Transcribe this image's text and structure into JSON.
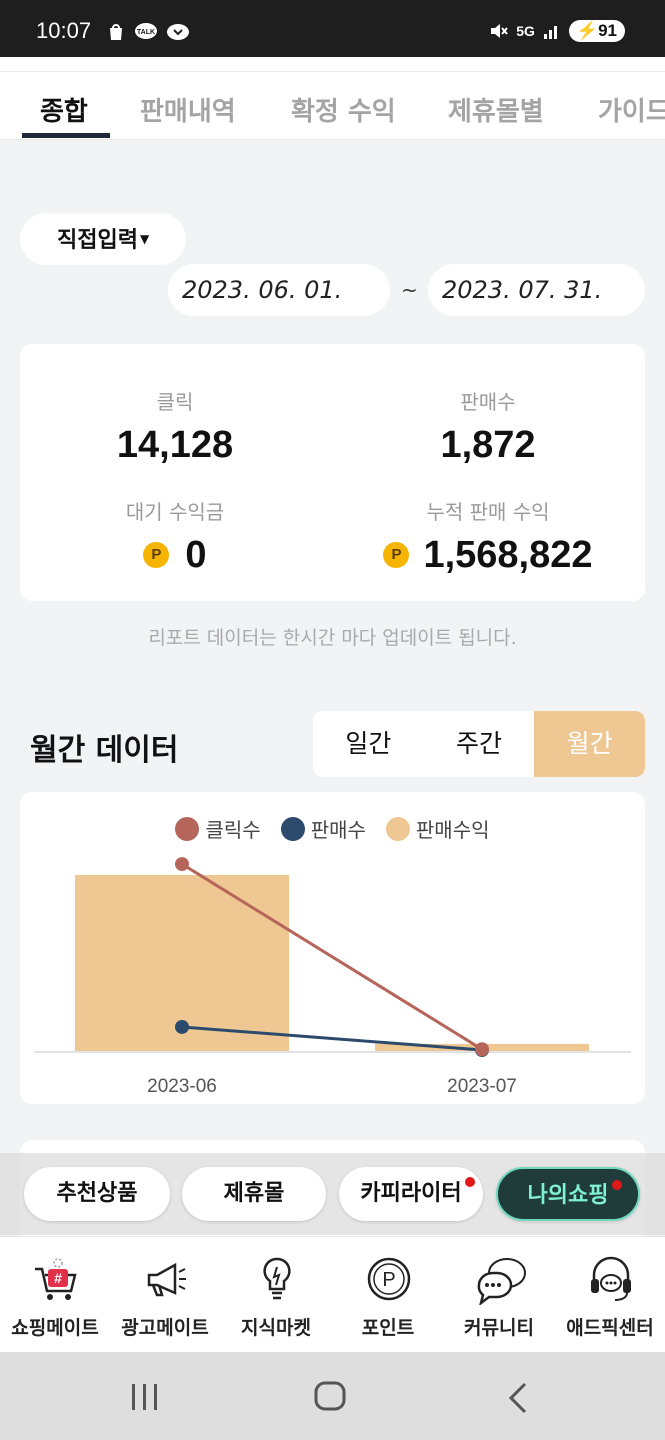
{
  "status_bar": {
    "time": "10:07",
    "left_icons": [
      "shopping-bag-icon",
      "kakaotalk-icon",
      "cloud-chat-icon"
    ],
    "network": "5G",
    "battery": "91"
  },
  "tabs": [
    {
      "label": "종합",
      "active": true
    },
    {
      "label": "판매내역",
      "active": false
    },
    {
      "label": "확정 수익",
      "active": false
    },
    {
      "label": "제휴몰별",
      "active": false
    },
    {
      "label": "가이드",
      "active": false
    }
  ],
  "date_filter": {
    "mode_label": "직접입력",
    "start_date": "2023. 06. 01.",
    "separator": "~",
    "end_date": "2023. 07. 31."
  },
  "summary": {
    "clicks_label": "클릭",
    "clicks_value": "14,128",
    "sales_label": "판매수",
    "sales_value": "1,872",
    "pending_label": "대기 수익금",
    "pending_value": "0",
    "cumulative_label": "누적 판매 수익",
    "cumulative_value": "1,568,822",
    "point_symbol": "P"
  },
  "notice": "리포트 데이터는 한시간 마다 업데이트 됩니다.",
  "monthly": {
    "title": "월간 데이터",
    "segments": [
      {
        "label": "일간",
        "active": false
      },
      {
        "label": "주간",
        "active": false
      },
      {
        "label": "월간",
        "active": true
      }
    ]
  },
  "chart_data": {
    "type": "bar",
    "categories": [
      "2023-06",
      "2023-07"
    ],
    "series": [
      {
        "name": "클릭수",
        "kind": "line",
        "color": "#b5655a",
        "values": [
          14000,
          128
        ]
      },
      {
        "name": "판매수",
        "kind": "line",
        "color": "#2c4a6b",
        "values": [
          1800,
          72
        ]
      },
      {
        "name": "판매수익",
        "kind": "bar",
        "color": "#efc793",
        "values": [
          1500000,
          68822
        ]
      }
    ],
    "legend": "top",
    "grid": false
  },
  "floating_buttons": [
    {
      "label": "추천상품",
      "active": false,
      "badge": false
    },
    {
      "label": "제휴몰",
      "active": false,
      "badge": false
    },
    {
      "label": "카피라이터",
      "active": false,
      "badge": true
    },
    {
      "label": "나의쇼핑",
      "active": true,
      "badge": true
    }
  ],
  "bottom_nav": [
    {
      "label": "쇼핑메이트",
      "icon": "shopping-cart-icon"
    },
    {
      "label": "광고메이트",
      "icon": "megaphone-icon"
    },
    {
      "label": "지식마켓",
      "icon": "lightbulb-icon"
    },
    {
      "label": "포인트",
      "icon": "point-icon"
    },
    {
      "label": "커뮤니티",
      "icon": "chat-bubbles-icon"
    },
    {
      "label": "애드픽센터",
      "icon": "headset-icon"
    }
  ],
  "colors": {
    "accent": "#efc793",
    "clicks": "#b5655a",
    "sales": "#2c4a6b",
    "dark_pill": "#1f3b3a"
  }
}
